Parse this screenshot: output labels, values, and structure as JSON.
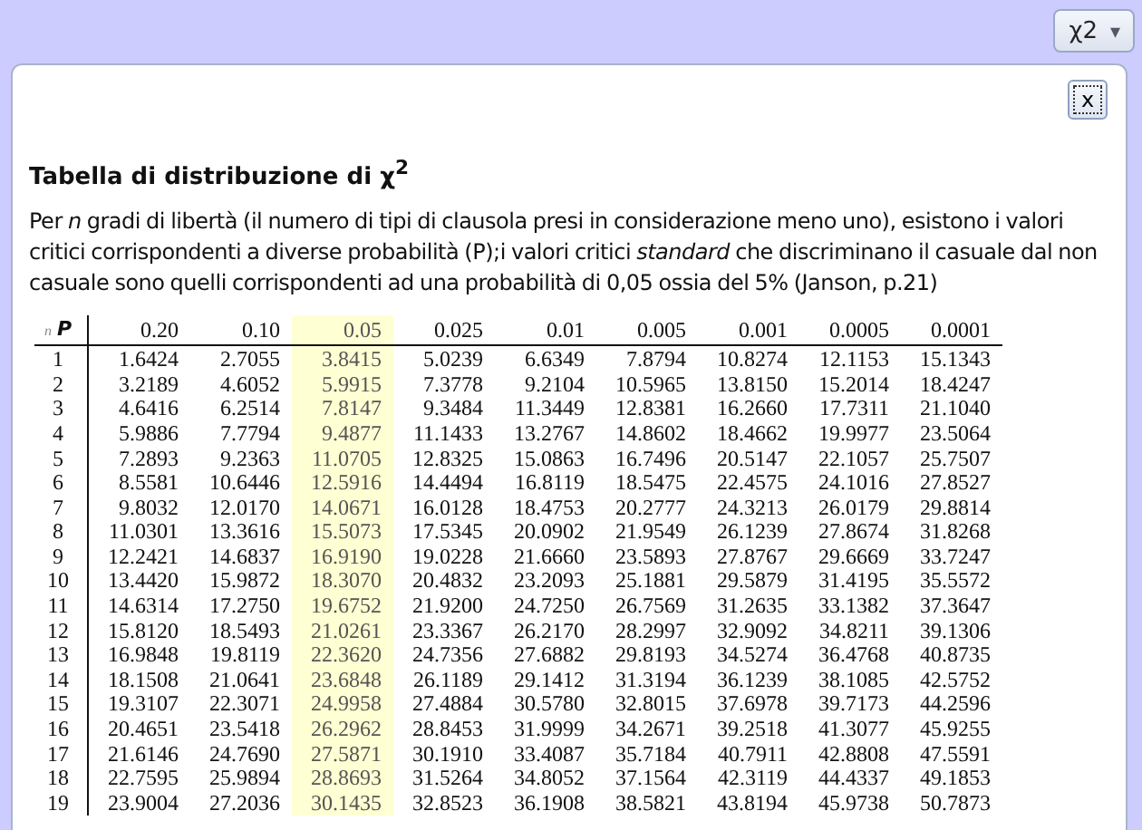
{
  "toolbar": {
    "menu_button": {
      "label": "χ2",
      "caret": "▾"
    }
  },
  "popup": {
    "close_label": "x",
    "title": "Tabella di distribuzione di χ$^{2}$",
    "description": "Per *n* gradi di libertà (il numero di tipi di clausola presi in considerazione meno uno), esistono i valori critici corrispondenti a diverse probabilità (P);i valori critici *standard* che discriminano il casuale dal non casuale sono quelli corrispondenti ad una probabilità di 0,05 ossia del 5% (Janson, p.21)",
    "table": {
      "corner_row_label": "n",
      "corner_col_label": "P",
      "columns": [
        {
          "label": "0.20",
          "selected": false
        },
        {
          "label": "0.10",
          "selected": false
        },
        {
          "label": "0.05",
          "selected": true
        },
        {
          "label": "0.025",
          "selected": false
        },
        {
          "label": "0.01",
          "selected": false
        },
        {
          "label": "0.005",
          "selected": false
        },
        {
          "label": "0.001",
          "selected": false
        },
        {
          "label": "0.0005",
          "selected": false
        },
        {
          "label": "0.0001",
          "selected": false
        }
      ],
      "rows": [
        {
          "n": "1",
          "values": [
            "1.6424",
            "2.7055",
            "3.8415",
            "5.0239",
            "6.6349",
            "7.8794",
            "10.8274",
            "12.1153",
            "15.1343"
          ]
        },
        {
          "n": "2",
          "values": [
            "3.2189",
            "4.6052",
            "5.9915",
            "7.3778",
            "9.2104",
            "10.5965",
            "13.8150",
            "15.2014",
            "18.4247"
          ]
        },
        {
          "n": "3",
          "values": [
            "4.6416",
            "6.2514",
            "7.8147",
            "9.3484",
            "11.3449",
            "12.8381",
            "16.2660",
            "17.7311",
            "21.1040"
          ]
        },
        {
          "n": "4",
          "values": [
            "5.9886",
            "7.7794",
            "9.4877",
            "11.1433",
            "13.2767",
            "14.8602",
            "18.4662",
            "19.9977",
            "23.5064"
          ]
        },
        {
          "n": "5",
          "values": [
            "7.2893",
            "9.2363",
            "11.0705",
            "12.8325",
            "15.0863",
            "16.7496",
            "20.5147",
            "22.1057",
            "25.7507"
          ]
        },
        {
          "n": "6",
          "values": [
            "8.5581",
            "10.6446",
            "12.5916",
            "14.4494",
            "16.8119",
            "18.5475",
            "22.4575",
            "24.1016",
            "27.8527"
          ]
        },
        {
          "n": "7",
          "values": [
            "9.8032",
            "12.0170",
            "14.0671",
            "16.0128",
            "18.4753",
            "20.2777",
            "24.3213",
            "26.0179",
            "29.8814"
          ]
        },
        {
          "n": "8",
          "values": [
            "11.0301",
            "13.3616",
            "15.5073",
            "17.5345",
            "20.0902",
            "21.9549",
            "26.1239",
            "27.8674",
            "31.8268"
          ]
        },
        {
          "n": "9",
          "values": [
            "12.2421",
            "14.6837",
            "16.9190",
            "19.0228",
            "21.6660",
            "23.5893",
            "27.8767",
            "29.6669",
            "33.7247"
          ]
        },
        {
          "n": "10",
          "values": [
            "13.4420",
            "15.9872",
            "18.3070",
            "20.4832",
            "23.2093",
            "25.1881",
            "29.5879",
            "31.4195",
            "35.5572"
          ]
        },
        {
          "n": "11",
          "values": [
            "14.6314",
            "17.2750",
            "19.6752",
            "21.9200",
            "24.7250",
            "26.7569",
            "31.2635",
            "33.1382",
            "37.3647"
          ]
        },
        {
          "n": "12",
          "values": [
            "15.8120",
            "18.5493",
            "21.0261",
            "23.3367",
            "26.2170",
            "28.2997",
            "32.9092",
            "34.8211",
            "39.1306"
          ]
        },
        {
          "n": "13",
          "values": [
            "16.9848",
            "19.8119",
            "22.3620",
            "24.7356",
            "27.6882",
            "29.8193",
            "34.5274",
            "36.4768",
            "40.8735"
          ]
        },
        {
          "n": "14",
          "values": [
            "18.1508",
            "21.0641",
            "23.6848",
            "26.1189",
            "29.1412",
            "31.3194",
            "36.1239",
            "38.1085",
            "42.5752"
          ]
        },
        {
          "n": "15",
          "values": [
            "19.3107",
            "22.3071",
            "24.9958",
            "27.4884",
            "30.5780",
            "32.8015",
            "37.6978",
            "39.7173",
            "44.2596"
          ]
        },
        {
          "n": "16",
          "values": [
            "20.4651",
            "23.5418",
            "26.2962",
            "28.8453",
            "31.9999",
            "34.2671",
            "39.2518",
            "41.3077",
            "45.9255"
          ]
        },
        {
          "n": "17",
          "values": [
            "21.6146",
            "24.7690",
            "27.5871",
            "30.1910",
            "33.4087",
            "35.7184",
            "40.7911",
            "42.8808",
            "47.5591"
          ]
        },
        {
          "n": "18",
          "values": [
            "22.7595",
            "25.9894",
            "28.8693",
            "31.5264",
            "34.8052",
            "37.1564",
            "42.3119",
            "44.4337",
            "49.1853"
          ]
        },
        {
          "n": "19",
          "values": [
            "23.9004",
            "27.2036",
            "30.1435",
            "32.8523",
            "36.1908",
            "38.5821",
            "43.8194",
            "45.9738",
            "50.7873"
          ]
        }
      ]
    }
  }
}
